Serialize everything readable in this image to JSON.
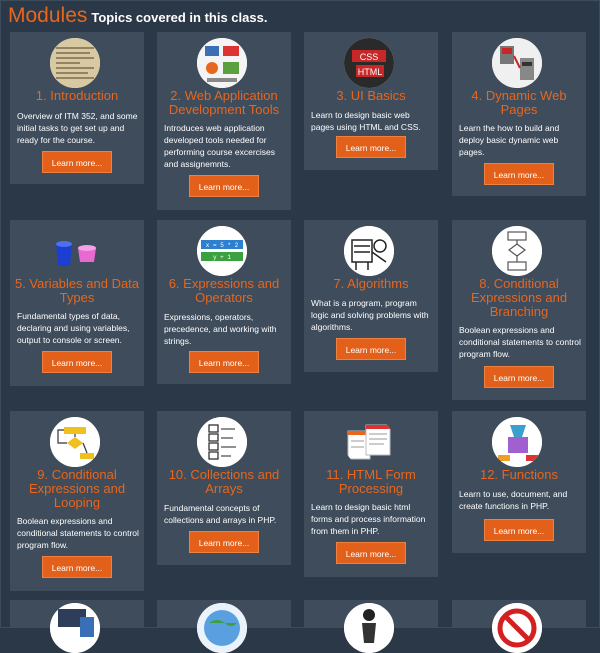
{
  "header": {
    "title": "Modules",
    "subtitle": "Topics covered in this class."
  },
  "modules": [
    {
      "title": "1. Introduction",
      "description": "Overview of ITM 352, and some initial tasks to get set up and ready for the course.",
      "button": "Learn more...",
      "icon": "newspaper-icon"
    },
    {
      "title": "2. Web Application Development Tools",
      "description": "Introduces web application developed tools needed for performing course excercises and assignemnts.",
      "button": "Learn more...",
      "icon": "tools-collage-icon"
    },
    {
      "title": "3. UI Basics",
      "description": "Learn to design basic web pages using HTML and CSS.",
      "button": "Learn more...",
      "icon": "css-html-icon"
    },
    {
      "title": "4. Dynamic Web Pages",
      "description": "Learn the how to build and deploy basic dynamic web pages.",
      "button": "Learn more...",
      "icon": "server-icon"
    },
    {
      "title": "5. Variables and Data Types",
      "description": "Fundamental types of data, declaring and using variables, output to console or screen.",
      "button": "Learn more...",
      "icon": "buckets-icon"
    },
    {
      "title": "6. Expressions and Operators",
      "description": "Expressions, operators, precedence, and working with strings.",
      "button": "Learn more...",
      "icon": "expression-icon"
    },
    {
      "title": "7. Algorithms",
      "description": "What is a program, program logic and solving problems with algorithms.",
      "button": "Learn more...",
      "icon": "machine-icon"
    },
    {
      "title": "8. Conditional Expressions and Branching",
      "description": "Boolean expressions and conditional statements to control program flow.",
      "button": "Learn more...",
      "icon": "flowchart-icon"
    },
    {
      "title": "9. Conditional Expressions and Looping",
      "description": "Boolean expressions and conditional statements to control program flow.",
      "button": "Learn more...",
      "icon": "loop-icon"
    },
    {
      "title": "10. Collections and Arrays",
      "description": "Fundamental concepts of collections and arrays in PHP.",
      "button": "Learn more...",
      "icon": "array-icon"
    },
    {
      "title": "11. HTML Form Processing",
      "description": "Learn to design basic html forms and process information from them in PHP.",
      "button": "Learn more...",
      "icon": "forms-icon"
    },
    {
      "title": "12. Functions",
      "description": "Learn to use, document, and create functions in PHP.",
      "button": "Learn more...",
      "icon": "function-machine-icon"
    }
  ],
  "partial_icons": [
    "devices-icon",
    "globe-icon",
    "figure-icon",
    "no-sign-icon"
  ]
}
